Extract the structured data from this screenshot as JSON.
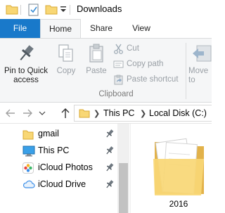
{
  "window": {
    "title": "Downloads"
  },
  "quick_access_toolbar": {
    "icons": [
      "folder-icon",
      "properties-icon",
      "new-folder-icon",
      "chevron-down-icon"
    ]
  },
  "ribbon": {
    "tabs": [
      {
        "label": "File",
        "active": false
      },
      {
        "label": "Home",
        "active": true
      },
      {
        "label": "Share",
        "active": false
      },
      {
        "label": "View",
        "active": false
      }
    ],
    "clipboard": {
      "group_label": "Clipboard",
      "pin_label": "Pin to Quick access",
      "copy_label": "Copy",
      "paste_label": "Paste",
      "cut_label": "Cut",
      "copy_path_label": "Copy path",
      "paste_shortcut_label": "Paste shortcut"
    },
    "organize": {
      "move_label": "Move to"
    }
  },
  "address_bar": {
    "breadcrumbs": [
      "This PC",
      "Local Disk (C:)"
    ]
  },
  "navigation_pane": {
    "items": [
      {
        "label": "gmail",
        "icon": "folder-icon",
        "pinned": true
      },
      {
        "label": "This PC",
        "icon": "computer-icon",
        "pinned": true
      },
      {
        "label": "iCloud Photos",
        "icon": "icloud-photos-icon",
        "pinned": true
      },
      {
        "label": "iCloud Drive",
        "icon": "icloud-drive-icon",
        "pinned": true
      }
    ]
  },
  "content": {
    "items": [
      {
        "label": "2016",
        "type": "folder"
      }
    ]
  },
  "colors": {
    "file_tab": "#1979ca",
    "ribbon_bg": "#f5f6f7",
    "folder": "#f8d775",
    "disabled_text": "#9aa0a6"
  }
}
